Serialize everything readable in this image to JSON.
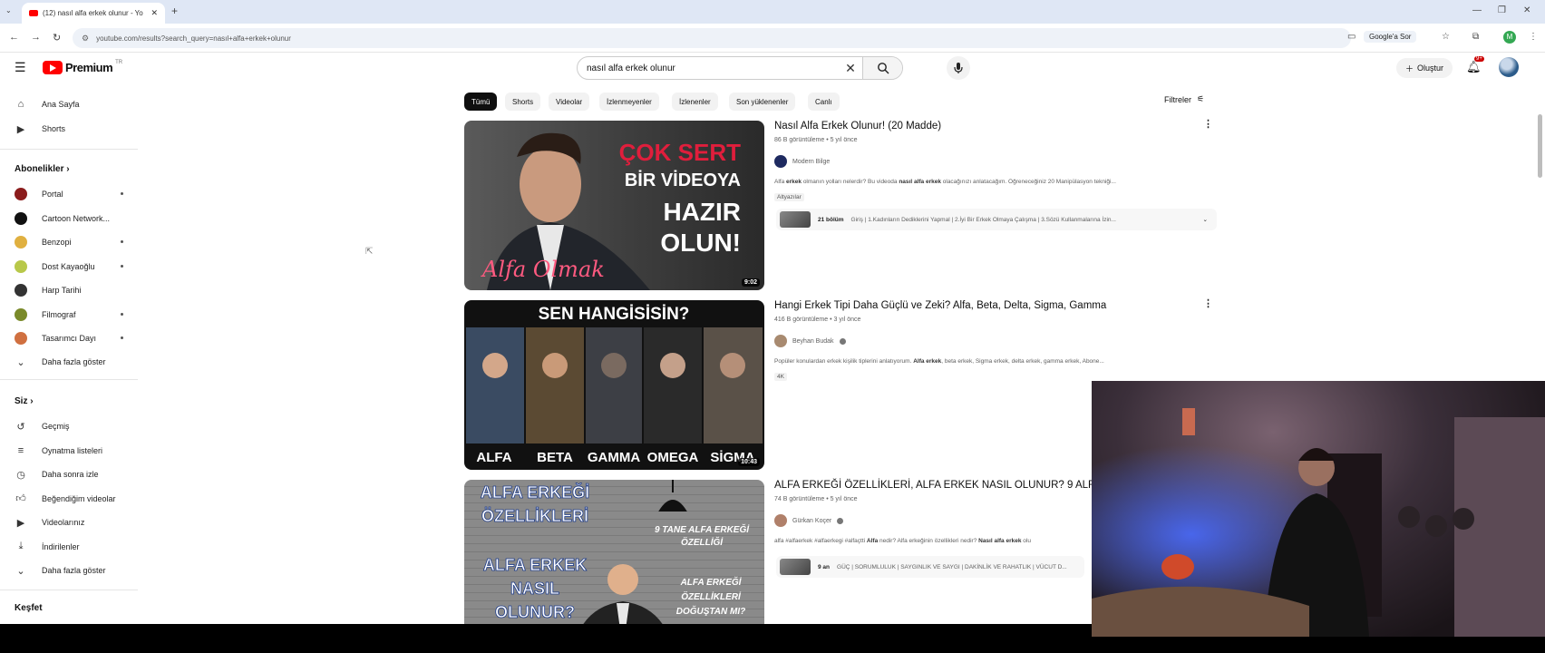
{
  "browser": {
    "tab_title": "(12) nasıl alfa erkek olunur - Yo",
    "tab_close": "✕",
    "new_tab": "+",
    "url": "youtube.com/results?search_query=nasıl+alfa+erkek+olunur",
    "google_ask": "Google'a Sor",
    "profile_initial": "M"
  },
  "header": {
    "logo_text": "Premium",
    "logo_country": "TR",
    "search_value": "nasıl alfa erkek olunur",
    "clear_symbol": "✕",
    "create_label": "Oluştur",
    "notif_count": "9+"
  },
  "sidebar": {
    "main": [
      {
        "label": "Ana Sayfa",
        "icon": "home-icon"
      },
      {
        "label": "Shorts",
        "icon": "shorts-icon"
      }
    ],
    "subs_heading": "Abonelikler",
    "subs": [
      {
        "label": "Portal",
        "color": "#8b1c1c",
        "dot": true
      },
      {
        "label": "Cartoon Network...",
        "color": "#111111",
        "dot": false
      },
      {
        "label": "Benzopi",
        "color": "#e0b040",
        "dot": true
      },
      {
        "label": "Dost Kayaoğlu",
        "color": "#b8c84a",
        "dot": true
      },
      {
        "label": "Harp Tarihi",
        "color": "#333333",
        "dot": false
      },
      {
        "label": "Filmograf",
        "color": "#7a8a2a",
        "dot": true
      },
      {
        "label": "Tasarımcı Dayı",
        "color": "#d07040",
        "dot": true
      }
    ],
    "subs_more": "Daha fazla göster",
    "you_heading": "Siz",
    "you": [
      {
        "label": "Geçmiş",
        "icon": "history-icon"
      },
      {
        "label": "Oynatma listeleri",
        "icon": "playlist-icon"
      },
      {
        "label": "Daha sonra izle",
        "icon": "watch-later-icon"
      },
      {
        "label": "Beğendiğim videolar",
        "icon": "like-icon"
      },
      {
        "label": "Videolarınız",
        "icon": "your-videos-icon"
      },
      {
        "label": "İndirilenler",
        "icon": "download-icon"
      }
    ],
    "you_more": "Daha fazla göster",
    "explore_heading": "Keşfet"
  },
  "chips": [
    "Tümü",
    "Shorts",
    "Videolar",
    "İzlenmeyenler",
    "İzlenenler",
    "Son yüklenenler",
    "Canlı"
  ],
  "filters_label": "Filtreler",
  "results": [
    {
      "title": "Nasıl Alfa Erkek Olunur! (20 Madde)",
      "meta": "86 B görüntüleme • 5 yıl önce",
      "channel": "Modern Bilge",
      "desc_pre": "Alfa ",
      "desc_b1": "erkek",
      "desc_mid": " olmanın yolları nelerdir? Bu videoda ",
      "desc_b2": "nasıl alfa erkek",
      "desc_post": " olacağınızı anlatacağım. Öğreneceğiniz 20 Manipülasyon tekniği...",
      "badge": "Altyazılar",
      "duration": "9:02",
      "chapters_count": "21 bölüm",
      "chapters_text": "Giriş | 1.Kadınların Dediklerini Yapmal | 2.İyi Bir Erkek Olmaya Çalışma | 3.Sözü Kullanmalarına İzin...",
      "thumb_lines": [
        "ÇOK SERT",
        "BİR VİDEOYA",
        "HAZIR",
        "OLUN!"
      ],
      "thumb_script": "Alfa Olmak"
    },
    {
      "title": "Hangi Erkek Tipi Daha Güçlü ve Zeki? Alfa, Beta, Delta, Sigma, Gamma",
      "meta": "416 B görüntüleme • 3 yıl önce",
      "channel": "Beyhan Budak",
      "desc_pre": "Popüler konulardan erkek kişilik tiplerini anlatıyorum. ",
      "desc_b1": "Alfa erkek",
      "desc_mid": ", beta erkek, Sigma erkek, delta erkek, gamma erkek, Abone...",
      "desc_b2": "",
      "desc_post": "",
      "badge": "4K",
      "duration": "10:43",
      "thumb_top": "SEN HANGİSİSİN?",
      "thumb_labels": [
        "ALFA",
        "BETA",
        "GAMMA",
        "OMEGA",
        "SİGMA"
      ]
    },
    {
      "title": "ALFA ERKEĞİ ÖZELLİKLERİ, ALFA ERKEK NASIL OLUNUR? 9 ALFA",
      "meta": "74 B görüntüleme • 5 yıl önce",
      "channel": "Gürkan Koçer",
      "desc_pre": "alfa #alfaerkek #alfaerkegi #alfaçtti ",
      "desc_b1": "Alfa",
      "desc_mid": " nedir? Alfa erkeğinin özellikleri nedir? ",
      "desc_b2": "Nasıl alfa erkek",
      "desc_post": " olu",
      "chapters_count": "9 an",
      "chapters_text": "GÜÇ | SORUMLULUK | SAYGINLIK VE SAYGI | DAKİNLİK VE RAHATLIK | VÜCUT D...",
      "thumb_lines": [
        "ALFA ERKEĞİ",
        "ÖZELLİKLERİ",
        "ALFA ERKEK",
        "NASIL",
        "OLUNUR?"
      ],
      "thumb_side": [
        "9 TANE ALFA ERKEĞİ",
        "ÖZELLİĞİ",
        "ALFA ERKEĞİ",
        "ÖZELLİKLERİ",
        "DOĞUŞTAN MI?"
      ]
    }
  ],
  "colors": {
    "brand": "#ff0000",
    "chip_active": "#0f0f0f",
    "thumb_red": "#e01e3c"
  }
}
